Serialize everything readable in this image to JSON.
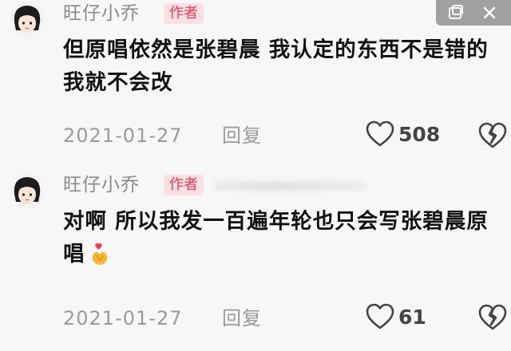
{
  "window_controls": {
    "pip_icon": "pip-icon",
    "close_icon": "close-icon"
  },
  "comments": [
    {
      "username": "旺仔小乔",
      "badge": "作者",
      "text": "但原唱依然是张碧晨 我认定的东西不是错的我就不会改",
      "date": "2021-01-27",
      "reply": "回复",
      "likes": "508"
    },
    {
      "username": "旺仔小乔",
      "badge": "作者",
      "text": "对啊 所以我发一百遍年轮也只会写张碧晨原唱",
      "date": "2021-01-27",
      "reply": "回复",
      "likes": "61",
      "emoji": "heart-hands-emoji"
    }
  ]
}
